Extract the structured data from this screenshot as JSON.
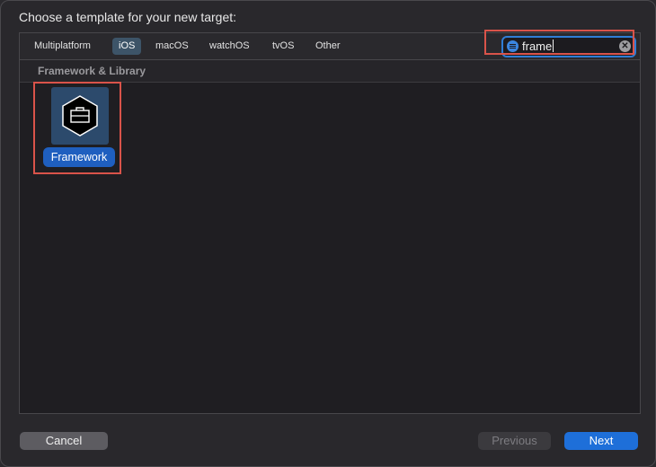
{
  "dialog": {
    "title": "Choose a template for your new target:"
  },
  "tabs": [
    {
      "label": "Multiplatform",
      "selected": false
    },
    {
      "label": "iOS",
      "selected": true
    },
    {
      "label": "macOS",
      "selected": false
    },
    {
      "label": "watchOS",
      "selected": false
    },
    {
      "label": "tvOS",
      "selected": false
    },
    {
      "label": "Other",
      "selected": false
    }
  ],
  "search": {
    "value": "frame",
    "icon": "filter-icon",
    "clear_icon": "clear-icon"
  },
  "section": {
    "title": "Framework & Library"
  },
  "templates": [
    {
      "label": "Framework",
      "icon": "toolbox-hexagon-icon",
      "selected": true
    }
  ],
  "buttons": {
    "cancel": "Cancel",
    "previous": "Previous",
    "next": "Next"
  },
  "colors": {
    "accent": "#1e6fd9",
    "highlight": "#d9534a"
  }
}
